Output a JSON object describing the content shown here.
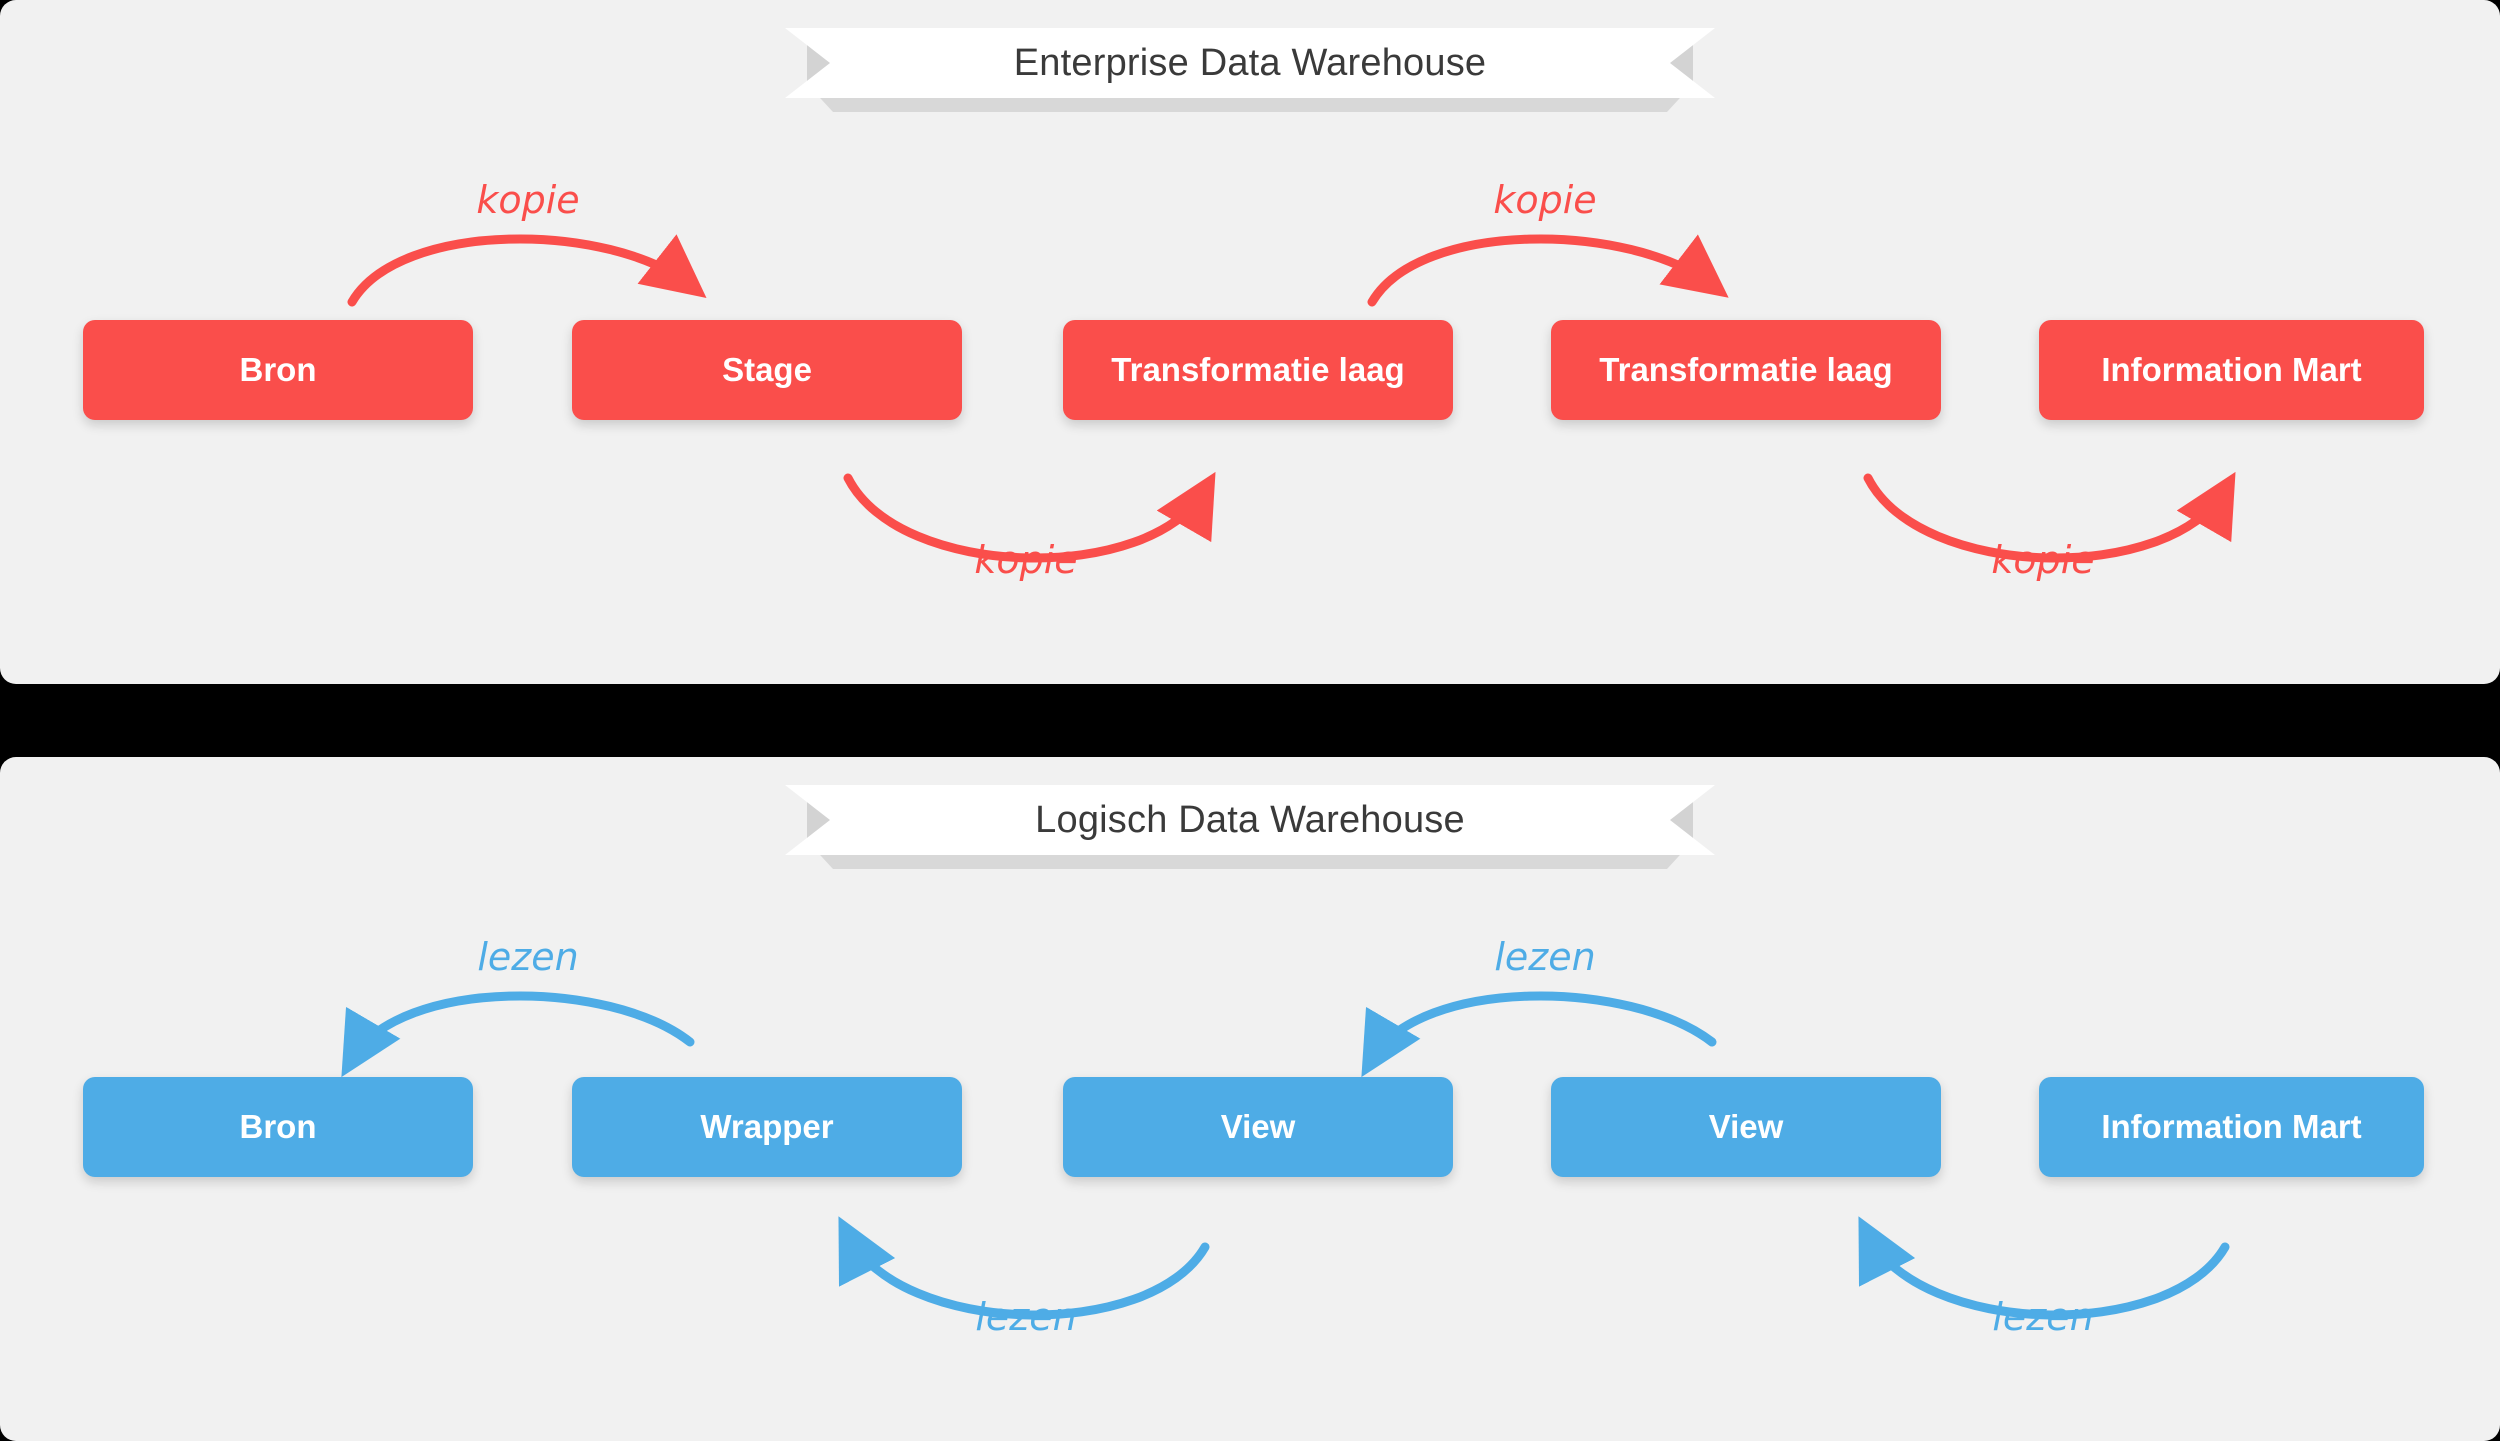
{
  "colors": {
    "background": "#000000",
    "panel": "#F1F1F1",
    "red": "#FA4E4B",
    "blue": "#4EACE6",
    "ribbon": "#FFFFFF",
    "ribbon_shadow": "#D3D3D3",
    "title_text": "#3A3A3A"
  },
  "panels": [
    {
      "title": "Enterprise Data Warehouse",
      "accent": "#FA4E4B",
      "nodes": [
        {
          "label": "Bron"
        },
        {
          "label": "Stage"
        },
        {
          "label": "Transformatie laag"
        },
        {
          "label": "Transformatie laag"
        },
        {
          "label": "Information Mart"
        }
      ],
      "arrows": [
        {
          "label": "kopie",
          "from": "Bron",
          "to": "Stage",
          "direction": "right",
          "position": "above"
        },
        {
          "label": "kopie",
          "from": "Stage",
          "to": "Transformatie laag",
          "direction": "right",
          "position": "below"
        },
        {
          "label": "kopie",
          "from": "Transformatie laag",
          "to": "Transformatie laag",
          "direction": "right",
          "position": "above"
        },
        {
          "label": "kopie",
          "from": "Transformatie laag",
          "to": "Information Mart",
          "direction": "right",
          "position": "below"
        }
      ]
    },
    {
      "title": "Logisch Data Warehouse",
      "accent": "#4EACE6",
      "nodes": [
        {
          "label": "Bron"
        },
        {
          "label": "Wrapper"
        },
        {
          "label": "View"
        },
        {
          "label": "View"
        },
        {
          "label": "Information Mart"
        }
      ],
      "arrows": [
        {
          "label": "lezen",
          "from": "Wrapper",
          "to": "Bron",
          "direction": "left",
          "position": "above"
        },
        {
          "label": "lezen",
          "from": "View",
          "to": "Wrapper",
          "direction": "left",
          "position": "below"
        },
        {
          "label": "lezen",
          "from": "View",
          "to": "View",
          "direction": "left",
          "position": "above"
        },
        {
          "label": "lezen",
          "from": "Information Mart",
          "to": "View",
          "direction": "left",
          "position": "below"
        }
      ]
    }
  ]
}
